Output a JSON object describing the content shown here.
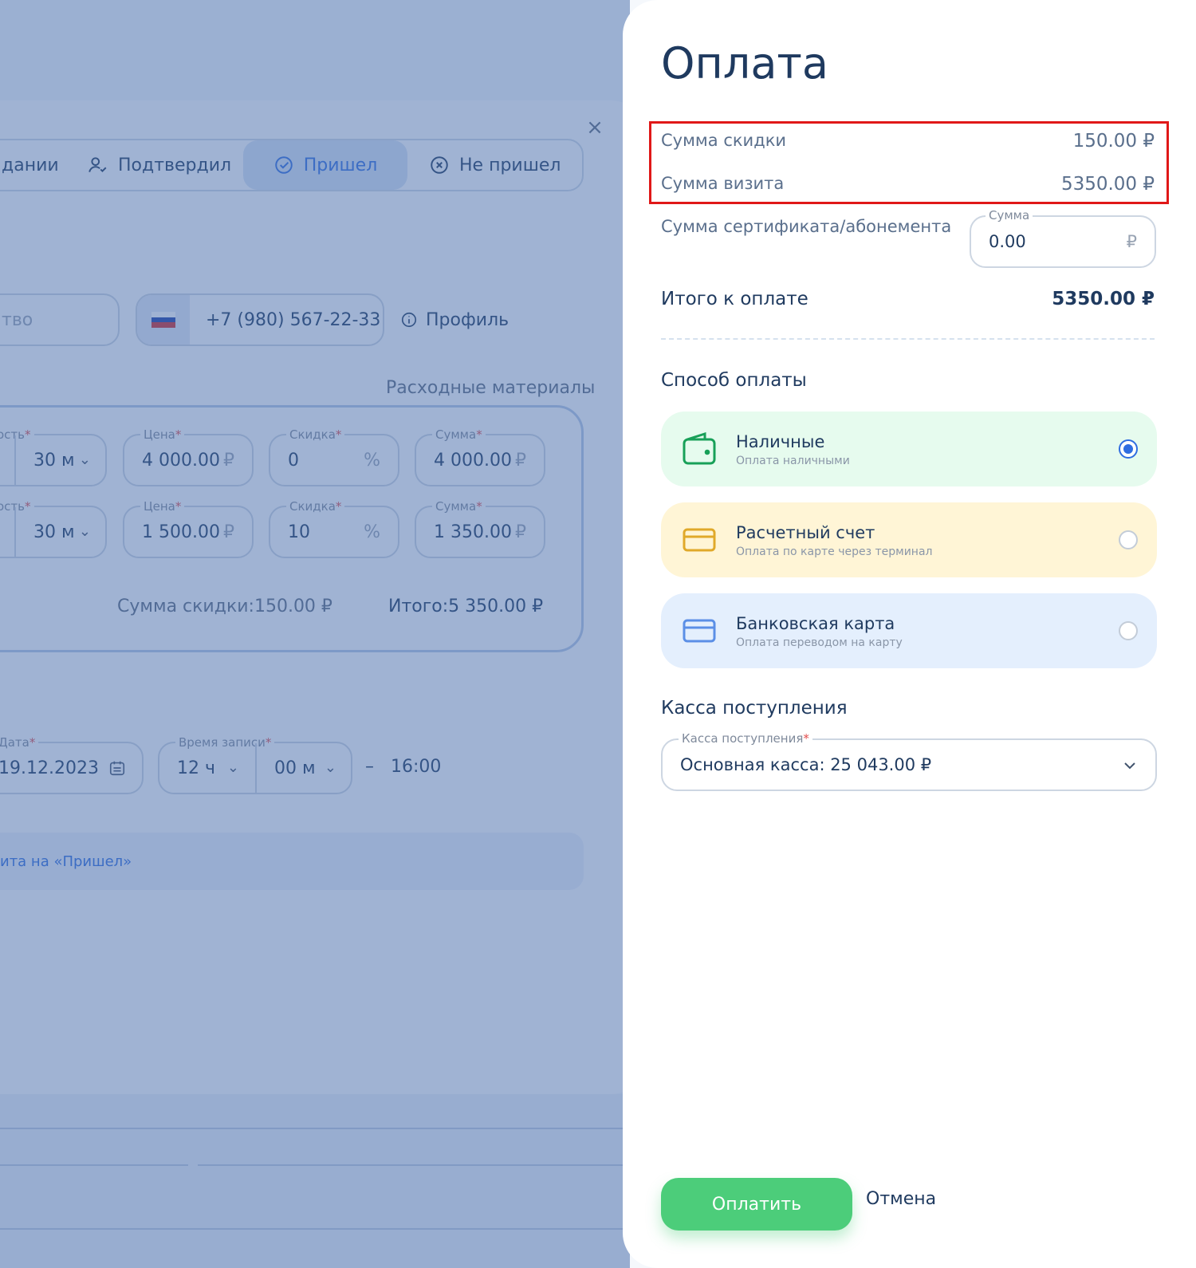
{
  "background": {
    "tabs": [
      {
        "label": "дании"
      },
      {
        "label": "Подтвердил"
      },
      {
        "label": "Пришел"
      },
      {
        "label": "Не пришел"
      }
    ],
    "citizenship_partial": "тво",
    "phone": "+7 (980) 567-22-33",
    "profile_label": "Профиль",
    "consumables_label": "Расходные материалы",
    "services": [
      {
        "duration_label": "ость",
        "duration": "30 м",
        "price_label": "Цена",
        "price": "4 000.00",
        "discount_label": "Скидка",
        "discount": "0",
        "sum_label": "Сумма",
        "sum": "4 000.00"
      },
      {
        "duration_label": "ость",
        "duration": "30 м",
        "price_label": "Цена",
        "price": "1 500.00",
        "discount_label": "Скидка",
        "discount": "10",
        "sum_label": "Сумма",
        "sum": "1 350.00"
      }
    ],
    "currency_symbol": "₽",
    "percent_symbol": "%",
    "required_mark": "*",
    "discount_total_label": "Сумма скидки:",
    "discount_total_value": "150.00 ₽",
    "grand_total_label": "Итого:",
    "grand_total_value": "5 350.00 ₽",
    "date_label": "Дата",
    "date": "19.12.2023",
    "time_label": "Время записи",
    "hour": "12 ч",
    "minute": "00 м",
    "dash": "–",
    "end_time": "16:00",
    "status_link": "ита на «Пришел»"
  },
  "panel": {
    "title": "Оплата",
    "discount_label": "Сумма скидки",
    "discount_value": "150.00 ₽",
    "visit_label": "Сумма визита",
    "visit_value": "5350.00 ₽",
    "certificate_label": "Сумма сертификата/абонемента",
    "certificate_input": {
      "label": "Сумма",
      "value": "0.00",
      "suffix": "₽"
    },
    "total_label": "Итого к оплате",
    "total_value": "5350.00 ₽",
    "payment_method_title": "Способ оплаты",
    "payment_methods": [
      {
        "name": "Наличные",
        "desc": "Оплата наличными",
        "selected": true,
        "color": "#e6fbee",
        "icon_color": "#18a058"
      },
      {
        "name": "Расчетный счет",
        "desc": "Оплата по карте через терминал",
        "selected": false,
        "color": "#fff5d6",
        "icon_color": "#e0a92a"
      },
      {
        "name": "Банковская карта",
        "desc": "Оплата переводом на карту",
        "selected": false,
        "color": "#e4effd",
        "icon_color": "#5b8fe6"
      }
    ],
    "kassa_title": "Касса поступления",
    "kassa_select": {
      "label": "Касса поступления",
      "value": "Основная касса: 25 043.00 ₽"
    },
    "pay_button": "Оплатить",
    "cancel_button": "Отмена"
  },
  "colors": {
    "accent": "#2f6de0",
    "primary_text": "#1f3a5f",
    "pay_button": "#4ccd7a",
    "highlight": "#e01818"
  }
}
